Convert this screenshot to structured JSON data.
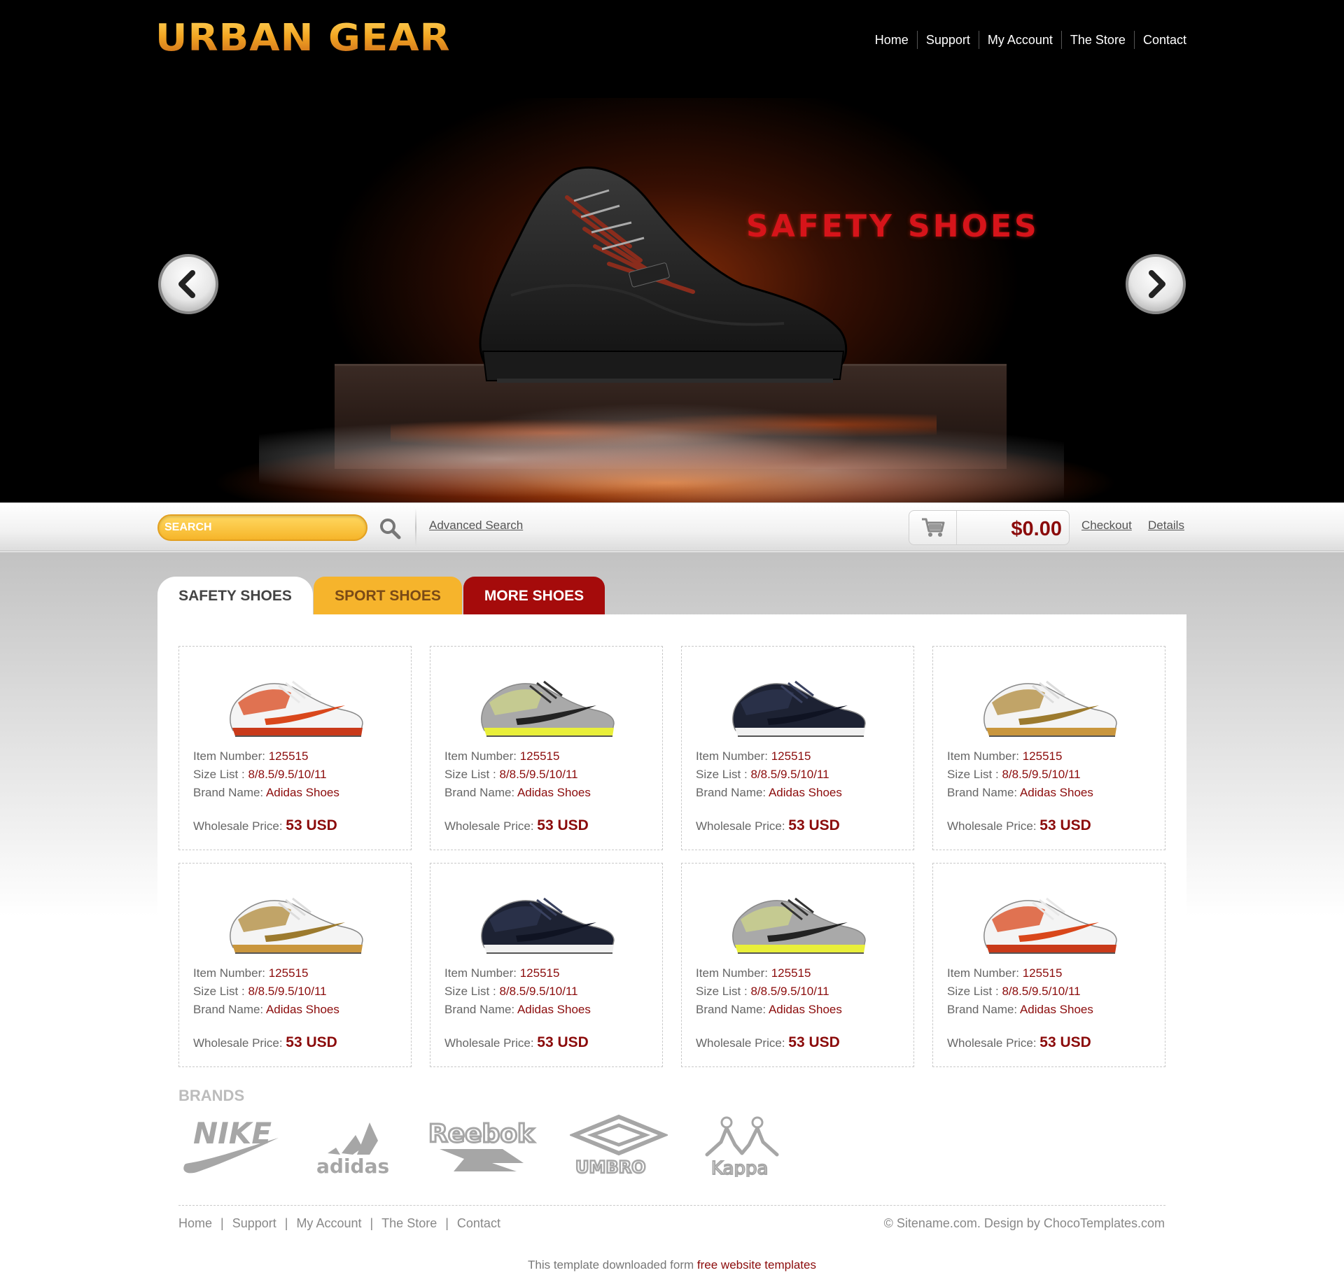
{
  "site": {
    "logo_text": "URBAN GEAR",
    "nav": [
      "Home",
      "Support",
      "My Account",
      "The Store",
      "Contact"
    ]
  },
  "hero": {
    "title": "SAFETY SHOES",
    "prev_icon": "chevron-left-icon",
    "next_icon": "chevron-right-icon"
  },
  "search": {
    "placeholder": "SEARCH",
    "advanced_label": "Advanced Search"
  },
  "cart": {
    "total": "$0.00",
    "checkout_label": "Checkout",
    "details_label": "Details"
  },
  "tabs": [
    {
      "label": "SAFETY SHOES",
      "color": "#ffffff"
    },
    {
      "label": "SPORT SHOES",
      "color": "#f6b42c"
    },
    {
      "label": "MORE SHOES",
      "color": "#a50b0b"
    }
  ],
  "labels": {
    "item_number": "Item Number:",
    "size_list": "Size List :",
    "brand_name": "Brand Name:",
    "wholesale_price": "Wholesale Price:"
  },
  "products": [
    {
      "item_number": "125515",
      "size_list": "8/8.5/9.5/10/11",
      "brand": "Adidas Shoes",
      "price": "53 USD",
      "style": "white-orange"
    },
    {
      "item_number": "125515",
      "size_list": "8/8.5/9.5/10/11",
      "brand": "Adidas Shoes",
      "price": "53 USD",
      "style": "yellow-grey"
    },
    {
      "item_number": "125515",
      "size_list": "8/8.5/9.5/10/11",
      "brand": "Adidas Shoes",
      "price": "53 USD",
      "style": "navy"
    },
    {
      "item_number": "125515",
      "size_list": "8/8.5/9.5/10/11",
      "brand": "Adidas Shoes",
      "price": "53 USD",
      "style": "white-gold"
    },
    {
      "item_number": "125515",
      "size_list": "8/8.5/9.5/10/11",
      "brand": "Adidas Shoes",
      "price": "53 USD",
      "style": "white-gold"
    },
    {
      "item_number": "125515",
      "size_list": "8/8.5/9.5/10/11",
      "brand": "Adidas Shoes",
      "price": "53 USD",
      "style": "navy"
    },
    {
      "item_number": "125515",
      "size_list": "8/8.5/9.5/10/11",
      "brand": "Adidas Shoes",
      "price": "53 USD",
      "style": "yellow-grey"
    },
    {
      "item_number": "125515",
      "size_list": "8/8.5/9.5/10/11",
      "brand": "Adidas Shoes",
      "price": "53 USD",
      "style": "white-orange"
    }
  ],
  "brands": {
    "title": "BRANDS",
    "logos": [
      "NIKE",
      "adidas",
      "Reebok",
      "UMBRO",
      "Kappa"
    ]
  },
  "footer": {
    "nav": [
      "Home",
      "Support",
      "My Account",
      "The Store",
      "Contact"
    ],
    "copyright": "© Sitename.com. Design by ChocoTemplates.com",
    "credit_prefix": "This template downloaded form ",
    "credit_link": "free website templates"
  },
  "colors": {
    "accent_red": "#8b0b0b",
    "accent_yellow": "#f6b42c",
    "hero_title": "#d6141a"
  }
}
